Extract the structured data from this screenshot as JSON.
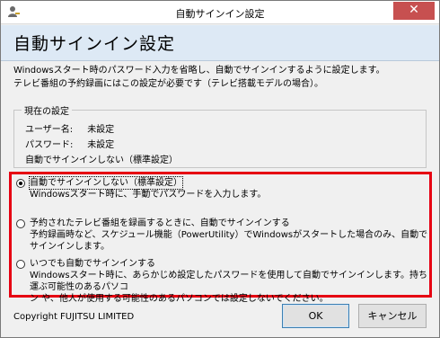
{
  "window": {
    "title": "自動サインイン設定",
    "close_symbol": "✕"
  },
  "header": {
    "title": "自動サインイン設定"
  },
  "description": {
    "line1": "Windowsスタート時のパスワード入力を省略し、自動でサインインするように設定します。",
    "line2": "テレビ番組の予約録画にはこの設定が必要です（テレビ搭載モデルの場合）。"
  },
  "current": {
    "legend": "現在の設定",
    "username_label": "ユーザー名:",
    "username_value": "未設定",
    "password_label": "パスワード:",
    "password_value": "未設定",
    "mode": "自動でサインインしない（標準設定）"
  },
  "options": [
    {
      "label": "自動でサインインしない（標準設定）",
      "desc": "Windowsスタート時に、手動でパスワードを入力します。",
      "checked": true
    },
    {
      "label": "予約されたテレビ番組を録画するときに、自動でサインインする",
      "desc": "予約録画時など、スケジュール機能（PowerUtility）でWindowsがスタートした場合のみ、自動でサインインします。",
      "checked": false
    },
    {
      "label": "いつでも自動でサインインする",
      "desc1": "Windowsスタート時に、あらかじめ設定したパスワードを使用して自動でサインインします。持ち運ぶ可能性のあるパソコ",
      "desc2": "ン や、他人が使用する可能性のあるパソコンでは設定しないでください。",
      "checked": false
    }
  ],
  "footer": {
    "copyright": "Copyright FUJITSU LIMITED",
    "ok_label": "OK",
    "cancel_label": "キャンセル"
  },
  "colors": {
    "highlight_border": "#e60012",
    "header_bg": "#dde9f5",
    "close_bg": "#c75050"
  }
}
